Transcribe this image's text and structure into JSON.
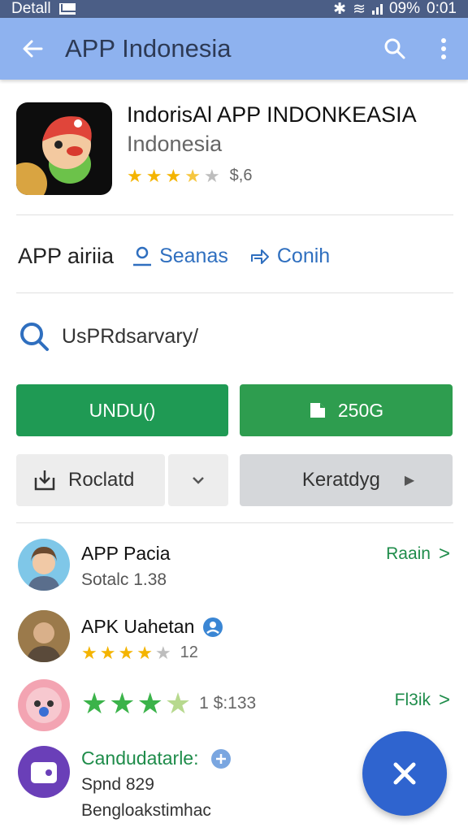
{
  "status_bar": {
    "left_label": "Detall",
    "battery": "09%",
    "time": "0:01"
  },
  "app_bar": {
    "title": "APP Indonesia",
    "back_icon": "arrow-left-icon",
    "search_icon": "search-icon",
    "more_icon": "more-vert-icon"
  },
  "app": {
    "title": "IndorisAl APP INDONKEASIA",
    "subtitle": "Indonesia",
    "rating_stars": 3.5,
    "rating_text": "$,6"
  },
  "tabs": {
    "label": "APP airiia",
    "links": [
      {
        "label": "Seanas",
        "icon": "user-icon"
      },
      {
        "label": "Conih",
        "icon": "share-icon"
      }
    ]
  },
  "search": {
    "text": "UsPRdsarvary/"
  },
  "buttons": {
    "primary": "UNDU()",
    "secondary": "250G",
    "reload": "Roclatd",
    "dropdown_icon": "chevron-down-icon",
    "kerat": "Keratdyg",
    "kerat_icon": "play-icon"
  },
  "list": [
    {
      "title": "APP Pacia",
      "sub": "Sotalc 1.38",
      "action": "Raain"
    },
    {
      "title": "APK Uahetan",
      "rating_stars": 4,
      "rating_text": "12"
    },
    {
      "rating_stars": 3.5,
      "rating_text": "1 $:133",
      "action": "Fl3ik"
    },
    {
      "title": "Candudatarle:",
      "sub": "Spnd 829",
      "sub2": "Bengloakstimhac"
    }
  ],
  "colors": {
    "app_bar": "#8eb2ef",
    "status_bar": "#4b5e86",
    "green": "#1f9a54",
    "fab": "#2f64cf",
    "link": "#2f6fbf"
  }
}
